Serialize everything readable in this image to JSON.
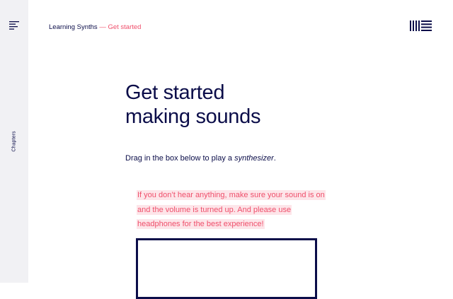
{
  "sidebar": {
    "menu_icon": "menu-lines-icon",
    "chapters_label": "Chapters"
  },
  "header": {
    "breadcrumb_root": "Learning Synths",
    "breadcrumb_separator": "—",
    "breadcrumb_current": "Get started",
    "logo_icon": "ableton-logo-icon"
  },
  "main": {
    "title_line1": "Get started",
    "title_line2": "making sounds",
    "intro_prefix": "Drag in the box below to play a ",
    "intro_emphasis": "synthesizer",
    "intro_suffix": ".",
    "notice": "If you don’t hear anything, make sure your sound is on and the volume is turned up. And please use headphones for the best experience!"
  },
  "colors": {
    "navy": "#0b0d49",
    "accent": "#ef4f6b",
    "notice_bg": "#fde5e9",
    "sidebar_bg": "#f1f1f4"
  }
}
